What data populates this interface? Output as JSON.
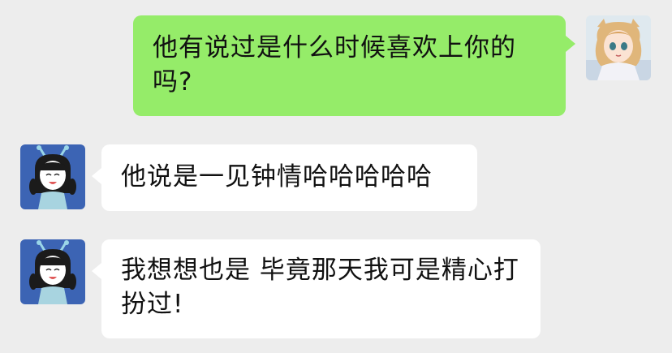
{
  "conversation": {
    "messages": [
      {
        "sender": "self",
        "text": "他有说过是什么时候喜欢上你的吗?"
      },
      {
        "sender": "other",
        "text": "他说是一见钟情哈哈哈哈哈"
      },
      {
        "sender": "other",
        "text": "我想想也是 毕竟那天我可是精心打扮过!"
      }
    ]
  },
  "colors": {
    "background": "#ededed",
    "outgoing_bubble": "#95ec69",
    "incoming_bubble": "#ffffff"
  },
  "icons": {
    "self_avatar": "anime-girl-avatar",
    "other_avatar": "cartoon-girl-avatar"
  }
}
